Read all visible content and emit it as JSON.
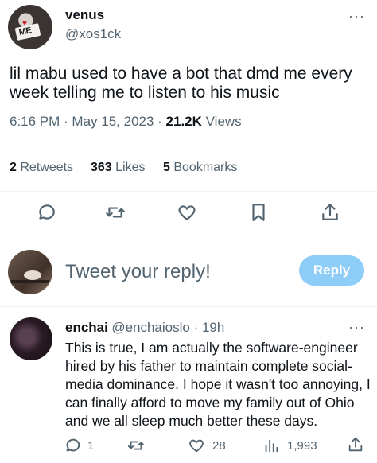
{
  "tweet": {
    "display_name": "venus",
    "handle": "@xos1ck",
    "more": "···",
    "text": "lil mabu used to have a bot that dmd me every week telling me to listen to his music",
    "time": "6:16 PM · May 15, 2023 · ",
    "views_count": "21.2K",
    "views_label": " Views",
    "avatar_text": "ME",
    "stats": {
      "retweets_count": "2",
      "retweets_label": "Retweets",
      "likes_count": "363",
      "likes_label": "Likes",
      "bookmarks_count": "5",
      "bookmarks_label": "Bookmarks"
    },
    "actions": [
      "reply-icon",
      "retweet-icon",
      "like-icon",
      "bookmark-icon",
      "share-icon"
    ]
  },
  "composer": {
    "placeholder": "Tweet your reply!",
    "reply_label": "Reply",
    "accent": "#8ecdf8"
  },
  "reply": {
    "display_name": "enchai",
    "handle": "@enchaioslo · 19h",
    "more": "···",
    "text": "This is true, I am actually the software-engineer hired by his father to maintain complete social-media dominance. I hope it wasn't too annoying, I can finally afford to move my family out of Ohio and we all sleep much better these days.",
    "replies": "1",
    "likes": "28",
    "views": "1,993"
  }
}
